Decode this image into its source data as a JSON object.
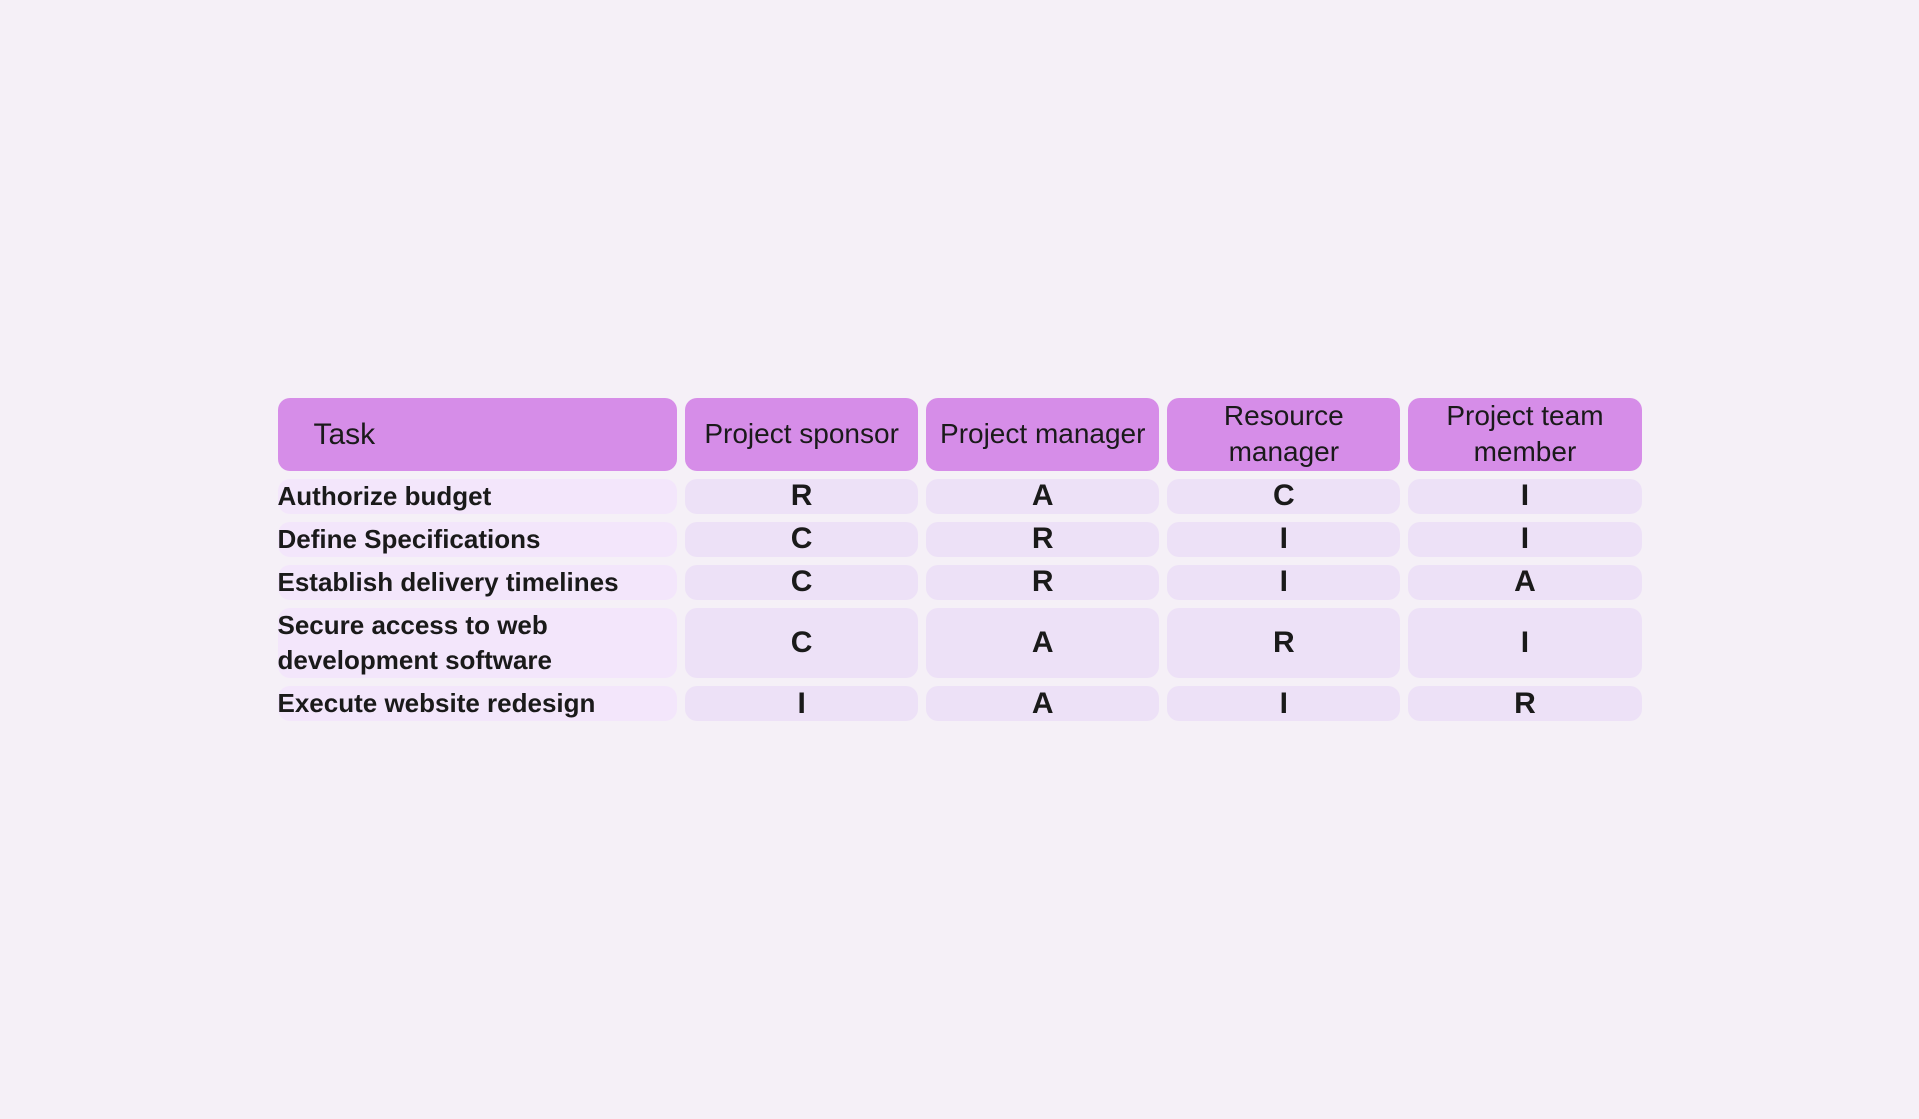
{
  "table": {
    "headers": {
      "task": "Task",
      "project_sponsor": "Project sponsor",
      "project_manager": "Project manager",
      "resource_manager": "Resource manager",
      "project_team_member": "Project team member"
    },
    "rows": [
      {
        "task": "Authorize budget",
        "sponsor": "R",
        "manager": "A",
        "resource": "C",
        "member": "I"
      },
      {
        "task": "Define Specifications",
        "sponsor": "C",
        "manager": "R",
        "resource": "I",
        "member": "I"
      },
      {
        "task": "Establish delivery timelines",
        "sponsor": "C",
        "manager": "R",
        "resource": "I",
        "member": "A"
      },
      {
        "task": "Secure access to web development software",
        "sponsor": "C",
        "manager": "A",
        "resource": "R",
        "member": "I"
      },
      {
        "task": "Execute website redesign",
        "sponsor": "I",
        "manager": "A",
        "resource": "I",
        "member": "R"
      }
    ]
  }
}
